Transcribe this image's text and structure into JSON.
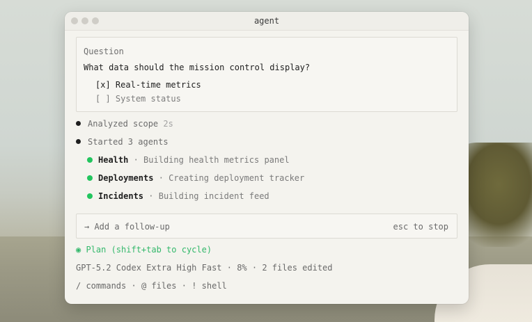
{
  "window": {
    "title": "agent"
  },
  "question": {
    "label": "Question",
    "text": "What data should the mission control display?",
    "options": [
      {
        "marker": "[x]",
        "label": "Real-time metrics",
        "selected": true
      },
      {
        "marker": "[ ]",
        "label": "System status",
        "selected": false
      }
    ]
  },
  "activity": [
    {
      "text": "Analyzed scope",
      "time": "2s"
    },
    {
      "text": "Started 3 agents",
      "time": ""
    }
  ],
  "agents": [
    {
      "name": "Health",
      "task": "Building health metrics panel"
    },
    {
      "name": "Deployments",
      "task": "Creating deployment tracker"
    },
    {
      "name": "Incidents",
      "task": "Building incident feed"
    }
  ],
  "followup": {
    "placeholder": "→ Add a follow-up",
    "stop_hint": "esc to stop"
  },
  "plan": {
    "label": "◉ Plan (shift+tab to cycle)"
  },
  "meta": {
    "model": "GPT-5.2 Codex Extra High Fast",
    "context": "8%",
    "files": "2 files edited"
  },
  "commands": {
    "slash": "/ commands",
    "at": "@ files",
    "bang": "! shell"
  },
  "colors": {
    "accent_green": "#22c55e",
    "plan_green": "#33b86b"
  }
}
